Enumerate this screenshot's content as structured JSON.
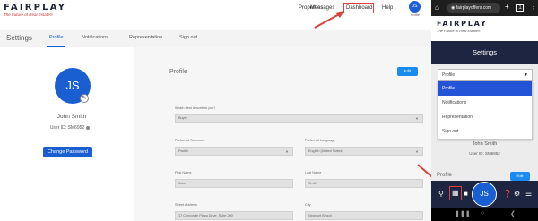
{
  "desktop": {
    "logo": "FAIRPLAY",
    "tagline": "The Future of Real Estate®",
    "nav": [
      "Properties",
      "Messages",
      "Dashboard",
      "Help"
    ],
    "avatar_initials": "JS",
    "avatar_label": "Profile",
    "settings_title": "Settings",
    "tabs": [
      "Profile",
      "Notifications",
      "Representation",
      "Sign out"
    ],
    "active_tab": "Profile",
    "user": {
      "initials": "JS",
      "name": "John Smith",
      "user_id": "User ID: SM6952"
    },
    "change_password_label": "Change Password",
    "profile_heading": "Profile",
    "edit_label": "Edit",
    "fields": {
      "describes_label": "Which best describes you?",
      "describes_value": "Buyer",
      "timezone_label": "Preferred Timezone",
      "timezone_value": "Pacific",
      "language_label": "Preferred Language",
      "language_value": "English (United States)",
      "first_name_label": "First Name",
      "first_name_value": "John",
      "last_name_label": "Last Name",
      "last_name_value": "Smith",
      "street_label": "Street Address",
      "street_value": "17 Corporate Plaza Drive, Suite 200",
      "city_label": "City",
      "city_value": "Newport Beach"
    }
  },
  "phone": {
    "url": "fairplayoffers.com",
    "logo": "FAIRPLAY",
    "tagline": "The Future of Real Estate®",
    "settings_title": "Settings",
    "select_value": "Profile",
    "menu": [
      "Profile",
      "Notifications",
      "Representation",
      "Sign out"
    ],
    "selected_item": "Profile",
    "user_name": "John Smith",
    "user_id": "User ID: SM6952",
    "profile_heading": "Profile",
    "edit_label": "Edit",
    "avatar_initials": "JS",
    "url_add_icon": "+",
    "tab_count_icon": "1",
    "menu_icon": "⋮"
  },
  "colors": {
    "brand_blue": "#1a5fd1",
    "edit_blue": "#1a8cf0",
    "navy": "#1e2540",
    "highlight_red": "#d9433b",
    "menu_selected": "#2353d6"
  }
}
